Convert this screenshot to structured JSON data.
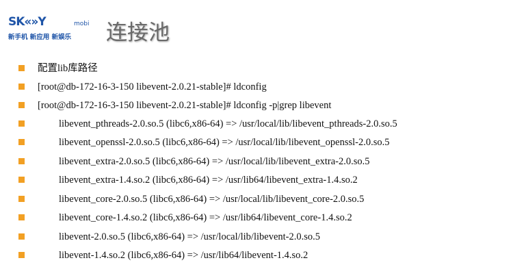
{
  "logo": {
    "brand": "SK«»Y",
    "sub": "mobi",
    "tagline": "新手机 新应用 新娱乐"
  },
  "title": "连接池",
  "colors": {
    "bullet": "#f2a024",
    "logo": "#1f55a8",
    "title": "#6a6a6a"
  },
  "items": [
    {
      "text": "配置lib库路径",
      "indent": false
    },
    {
      "text": "[root@db-172-16-3-150 libevent-2.0.21-stable]# ldconfig",
      "indent": false
    },
    {
      "text": "[root@db-172-16-3-150 libevent-2.0.21-stable]# ldconfig -p|grep libevent",
      "indent": false
    },
    {
      "text": "libevent_pthreads-2.0.so.5 (libc6,x86-64) => /usr/local/lib/libevent_pthreads-2.0.so.5",
      "indent": true
    },
    {
      "text": "libevent_openssl-2.0.so.5 (libc6,x86-64) => /usr/local/lib/libevent_openssl-2.0.so.5",
      "indent": true
    },
    {
      "text": "libevent_extra-2.0.so.5 (libc6,x86-64) => /usr/local/lib/libevent_extra-2.0.so.5",
      "indent": true
    },
    {
      "text": "libevent_extra-1.4.so.2 (libc6,x86-64) => /usr/lib64/libevent_extra-1.4.so.2",
      "indent": true
    },
    {
      "text": "libevent_core-2.0.so.5 (libc6,x86-64) => /usr/local/lib/libevent_core-2.0.so.5",
      "indent": true
    },
    {
      "text": "libevent_core-1.4.so.2 (libc6,x86-64) => /usr/lib64/libevent_core-1.4.so.2",
      "indent": true
    },
    {
      "text": "libevent-2.0.so.5 (libc6,x86-64) => /usr/local/lib/libevent-2.0.so.5",
      "indent": true
    },
    {
      "text": "libevent-1.4.so.2 (libc6,x86-64) => /usr/lib64/libevent-1.4.so.2",
      "indent": true
    }
  ]
}
